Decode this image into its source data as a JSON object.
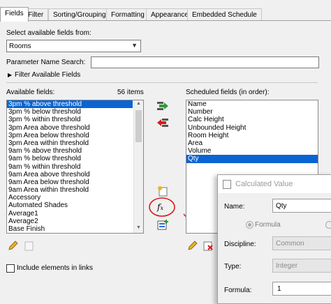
{
  "tabs": [
    "Fields",
    "Filter",
    "Sorting/Grouping",
    "Formatting",
    "Appearance",
    "Embedded Schedule"
  ],
  "select_label": "Select available fields from:",
  "category_value": "Rooms",
  "param_search_label": "Parameter Name Search:",
  "filter_toggle_label": "Filter Available Fields",
  "available_label": "Available fields:",
  "available_count": "56 items",
  "available_fields": [
    "3pm % above threshold",
    "3pm % below threshold",
    "3pm % within threshold",
    "3pm Area above threshold",
    "3pm Area below threshold",
    "3pm Area within threshold",
    "9am % above threshold",
    "9am % below threshold",
    "9am % within threshold",
    "9am Area above threshold",
    "9am Area below threshold",
    "9am Area within threshold",
    "Accessory",
    "Automated Shades",
    "Average1",
    "Average2",
    "Base Finish"
  ],
  "scheduled_label": "Scheduled fields (in order):",
  "scheduled_fields": [
    "Name",
    "Number",
    "Calc Height",
    "Unbounded Height",
    "Room Height",
    "Area",
    "Volume",
    "Qty"
  ],
  "include_links_label": "Include elements in links",
  "dialog": {
    "title": "Calculated Value",
    "name_label": "Name:",
    "name_value": "Qty",
    "formula_radio": "Formula",
    "discipline_label": "Discipline:",
    "discipline_value": "Common",
    "type_label": "Type:",
    "type_value": "Integer",
    "formula_label": "Formula:",
    "formula_value": "1"
  },
  "colors": {
    "selection": "#0a64d2",
    "annotation": "#d81b1b",
    "add_arrow": "#2e9b3a",
    "remove_arrow": "#d81b1b"
  },
  "icons": [
    "add-field-arrow-icon",
    "remove-field-arrow-icon",
    "new-parameter-icon",
    "calculated-value-fx-icon",
    "combine-parameters-icon",
    "edit-pencil-icon",
    "delete-parameter-icon"
  ]
}
